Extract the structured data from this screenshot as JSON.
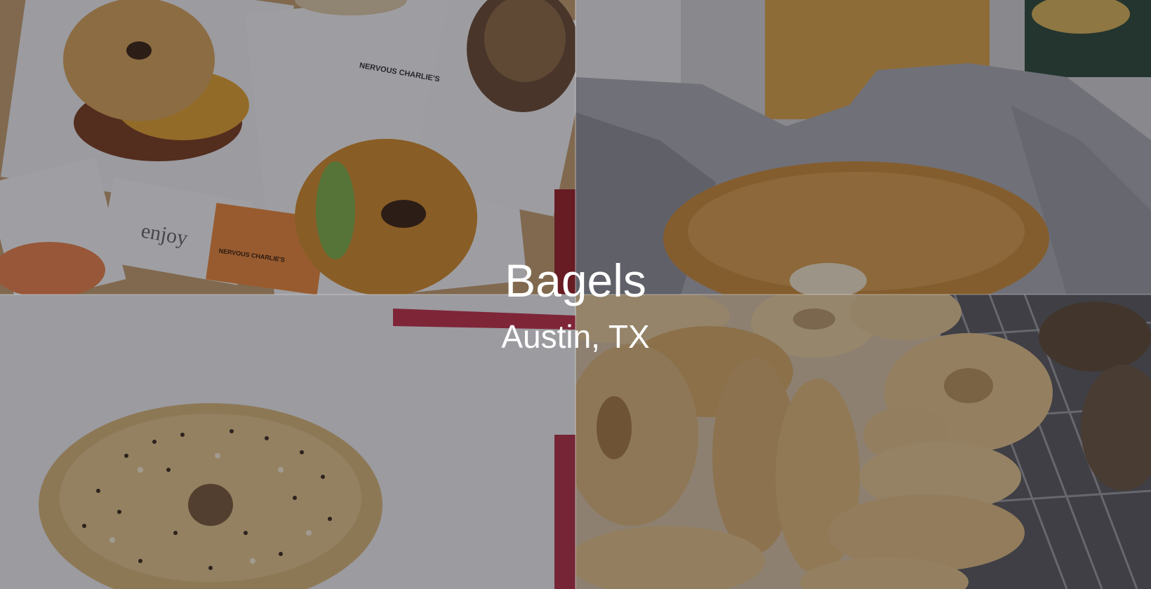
{
  "hero": {
    "title": "Bagels",
    "subtitle": "Austin, TX"
  },
  "photos": [
    {
      "label": "nervous charlies sandwiches",
      "card_brand": "NERVOUS CHARLIE'S",
      "card_text": "enjoy"
    },
    {
      "label": "bagel in foil"
    },
    {
      "label": "everything bagel on paper"
    },
    {
      "label": "basket of plain bagels"
    }
  ],
  "colors": {
    "overlay": "#14141e",
    "title_text": "#ffffff",
    "bagel_crust": "#c98a3a",
    "foil": "#a9a9b0",
    "paper": "#eeeef0"
  }
}
